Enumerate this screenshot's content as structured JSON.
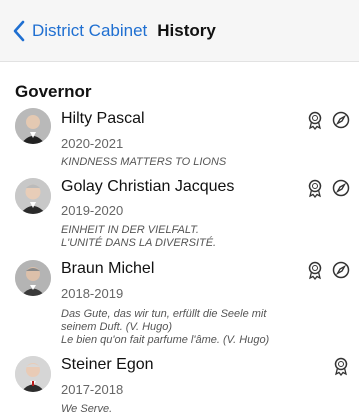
{
  "nav": {
    "back_label": "District Cabinet",
    "title": "History"
  },
  "section": {
    "title": "Governor"
  },
  "governors": [
    {
      "name": "Hilty Pascal",
      "years": "2020-2021",
      "motto_lines": [
        "KINDNESS MATTERS TO LIONS"
      ],
      "icons": [
        "award-ribbon-icon",
        "compass-icon"
      ]
    },
    {
      "name": "Golay Christian Jacques",
      "years": "2019-2020",
      "motto_lines": [
        "EINHEIT IN DER VIELFALT.",
        "L'UNITÉ DANS LA DIVERSITÉ."
      ],
      "icons": [
        "award-ribbon-icon",
        "compass-icon"
      ]
    },
    {
      "name": "Braun Michel",
      "years": "2018-2019",
      "motto_lines": [
        "Das Gute, das wir tun, erfüllt die Seele mit",
        "seinem Duft. (V. Hugo)",
        "Le bien qu'on fait parfume l'âme. (V. Hugo)"
      ],
      "icons": [
        "award-ribbon-icon",
        "compass-icon"
      ]
    },
    {
      "name": "Steiner Egon",
      "years": "2017-2018",
      "motto_lines": [
        "We Serve."
      ],
      "icons": [
        "award-ribbon-icon"
      ]
    }
  ],
  "colors": {
    "accent": "#1f6fd1",
    "navbar_bg": "#f6f6f6"
  }
}
